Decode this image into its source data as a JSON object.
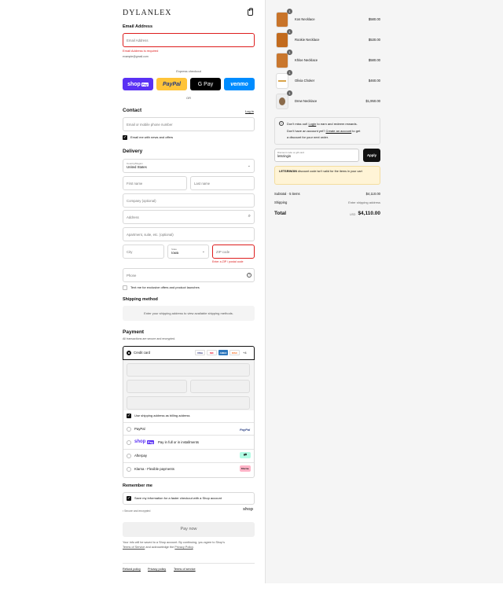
{
  "brand": {
    "logo": "DYLANLEX"
  },
  "email": {
    "heading": "Email Address",
    "placeholder": "Email Address",
    "error": "Email Address is required",
    "hint": "example@gmail.com"
  },
  "express": {
    "label": "Express checkout",
    "or": "OR",
    "shop_pay": "shop",
    "shop_pay_badge": "Pay",
    "paypal": "PayPal",
    "gpay": "G Pay",
    "venmo": "venmo"
  },
  "contact": {
    "heading": "Contact",
    "login": "Log in",
    "placeholder": "Email or mobile phone number",
    "news_label": "Email me with news and offers"
  },
  "delivery": {
    "heading": "Delivery",
    "country_label": "Country/Region",
    "country_value": "United States",
    "first_name": "First name",
    "last_name": "Last name",
    "company": "Company (optional)",
    "address": "Address",
    "apartment": "Apartment, suite, etc. (optional)",
    "city": "City",
    "state_label": "State",
    "state_value": "Iowa",
    "zip": "ZIP code",
    "zip_error": "Enter a ZIP / postal code",
    "phone": "Phone",
    "text_offers": "Text me for exclusive offers and product launches"
  },
  "shipping": {
    "heading": "Shipping method",
    "placeholder": "Enter your shipping address to view available shipping methods."
  },
  "payment": {
    "heading": "Payment",
    "subtitle": "All transactions are secure and encrypted.",
    "credit_card": "Credit card",
    "cards": [
      "VISA",
      "MC",
      "AMEX",
      "DISC"
    ],
    "more_cards": "+4",
    "billing_same": "Use shipping address as billing address",
    "paypal": "PayPal",
    "paypal_logo": "PayPal",
    "shoppay_text": "Pay in full or in installments",
    "shoppay_logo": "shop",
    "shoppay_badge": "Pay",
    "afterpay": "Afterpay",
    "klarna": "Klarna - Flexible payments",
    "klarna_logo": "Klarna."
  },
  "remember": {
    "heading": "Remember me",
    "save_label": "Save my information for a faster checkout with a Shop account",
    "secure": "Secure and encrypted",
    "shop": "shop"
  },
  "pay_now": "Pay now",
  "legal": {
    "line1": "Your info will be saved to a Shop account. By continuing, you agree to Shop's",
    "tos": "Terms of Service",
    "and": "and acknowledge the",
    "privacy": "Privacy Policy",
    "end": "."
  },
  "footer": {
    "refund": "Refund policy",
    "privacy": "Privacy policy",
    "terms": "Terms of service"
  },
  "cart": {
    "items": [
      {
        "name": "Kos Necklace",
        "price": "$580.00",
        "qty": "1"
      },
      {
        "name": "Rookie Necklace",
        "price": "$530.00",
        "qty": "1"
      },
      {
        "name": "Khloe Necklace",
        "price": "$580.00",
        "qty": "1"
      },
      {
        "name": "Olivia Choker",
        "price": "$460.00",
        "qty": "1"
      },
      {
        "name": "Drew Necklace",
        "price": "$1,950.00",
        "qty": "1"
      }
    ],
    "rewards": {
      "pre": "Don't miss out!",
      "login": "Login",
      "mid": "to earn and redeem rewards.",
      "line2": "Don't have an account yet?",
      "create": "Create an account",
      "post": "to get",
      "line3": "a discount for your next order."
    },
    "discount_label": "Discount code or gift card",
    "discount_value": "letsringin",
    "apply": "Apply",
    "discount_error_code": "LETSRINGIN",
    "discount_error": "discount code isn't valid for the items in your cart",
    "subtotal_label": "Subtotal · 5 items",
    "subtotal": "$4,110.00",
    "shipping_label": "Shipping",
    "shipping_value": "Enter shipping address",
    "total_label": "Total",
    "currency": "USD",
    "total": "$4,110.00"
  }
}
